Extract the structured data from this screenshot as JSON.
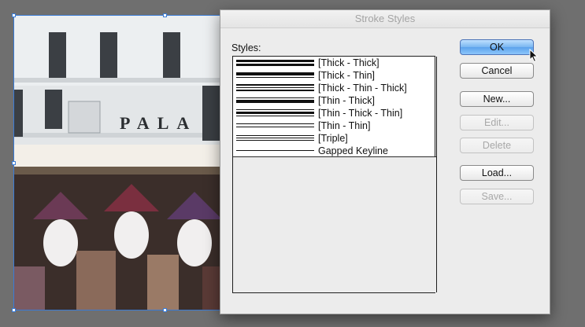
{
  "window": {
    "title": "Stroke Styles"
  },
  "styles_label": "Styles:",
  "styles": [
    {
      "name": "[Thick - Thick]"
    },
    {
      "name": "[Thick - Thin]"
    },
    {
      "name": "[Thick - Thin - Thick]"
    },
    {
      "name": "[Thin - Thick]"
    },
    {
      "name": "[Thin - Thick - Thin]"
    },
    {
      "name": "[Thin - Thin]"
    },
    {
      "name": "[Triple]"
    },
    {
      "name": "Gapped Keyline"
    }
  ],
  "buttons": {
    "ok": "OK",
    "cancel": "Cancel",
    "new": "New...",
    "edit": "Edit...",
    "delete": "Delete",
    "load": "Load...",
    "save": "Save..."
  },
  "photo": {
    "sign_text": "PALA"
  },
  "colors": {
    "default_button": "#5ca2ec",
    "selection": "#3a7bd5"
  }
}
